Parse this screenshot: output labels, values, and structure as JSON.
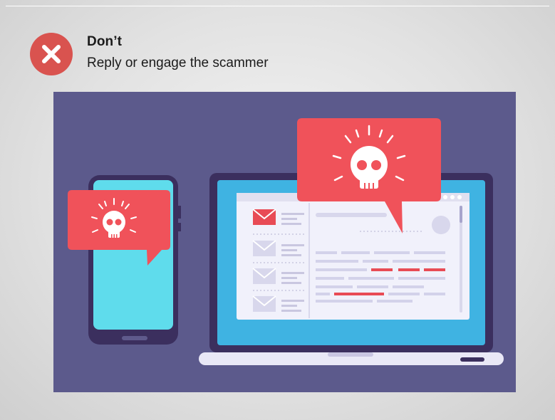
{
  "slide": {
    "heading": "Don’t",
    "subtext": "Reply or engage the scammer"
  },
  "icons": {
    "status": "close-x-icon",
    "alert": "skull-icon",
    "email": "envelope-icon"
  },
  "colors": {
    "dont_badge": "#d9534f",
    "alert_bubble": "#f0525a",
    "panel_background": "#5c5a8c",
    "laptop_screen": "#3fb3e2",
    "phone_screen": "#5fdcec",
    "device_frame": "#3b2f5e"
  }
}
